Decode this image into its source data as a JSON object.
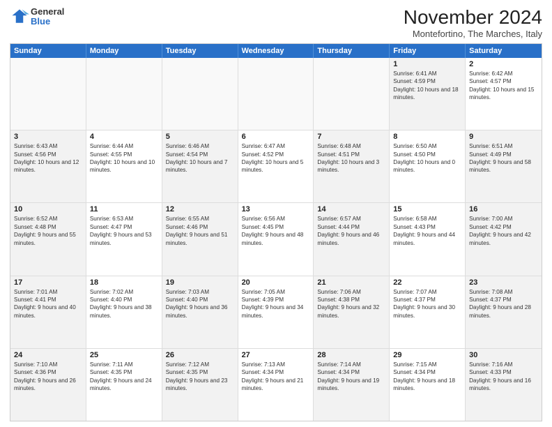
{
  "logo": {
    "general": "General",
    "blue": "Blue"
  },
  "title": "November 2024",
  "location": "Montefortino, The Marches, Italy",
  "weekdays": [
    "Sunday",
    "Monday",
    "Tuesday",
    "Wednesday",
    "Thursday",
    "Friday",
    "Saturday"
  ],
  "rows": [
    [
      {
        "day": "",
        "text": "",
        "empty": true
      },
      {
        "day": "",
        "text": "",
        "empty": true
      },
      {
        "day": "",
        "text": "",
        "empty": true
      },
      {
        "day": "",
        "text": "",
        "empty": true
      },
      {
        "day": "",
        "text": "",
        "empty": true
      },
      {
        "day": "1",
        "text": "Sunrise: 6:41 AM\nSunset: 4:59 PM\nDaylight: 10 hours and 18 minutes.",
        "shaded": true
      },
      {
        "day": "2",
        "text": "Sunrise: 6:42 AM\nSunset: 4:57 PM\nDaylight: 10 hours and 15 minutes.",
        "shaded": false
      }
    ],
    [
      {
        "day": "3",
        "text": "Sunrise: 6:43 AM\nSunset: 4:56 PM\nDaylight: 10 hours and 12 minutes.",
        "shaded": true
      },
      {
        "day": "4",
        "text": "Sunrise: 6:44 AM\nSunset: 4:55 PM\nDaylight: 10 hours and 10 minutes.",
        "shaded": false
      },
      {
        "day": "5",
        "text": "Sunrise: 6:46 AM\nSunset: 4:54 PM\nDaylight: 10 hours and 7 minutes.",
        "shaded": true
      },
      {
        "day": "6",
        "text": "Sunrise: 6:47 AM\nSunset: 4:52 PM\nDaylight: 10 hours and 5 minutes.",
        "shaded": false
      },
      {
        "day": "7",
        "text": "Sunrise: 6:48 AM\nSunset: 4:51 PM\nDaylight: 10 hours and 3 minutes.",
        "shaded": true
      },
      {
        "day": "8",
        "text": "Sunrise: 6:50 AM\nSunset: 4:50 PM\nDaylight: 10 hours and 0 minutes.",
        "shaded": false
      },
      {
        "day": "9",
        "text": "Sunrise: 6:51 AM\nSunset: 4:49 PM\nDaylight: 9 hours and 58 minutes.",
        "shaded": true
      }
    ],
    [
      {
        "day": "10",
        "text": "Sunrise: 6:52 AM\nSunset: 4:48 PM\nDaylight: 9 hours and 55 minutes.",
        "shaded": true
      },
      {
        "day": "11",
        "text": "Sunrise: 6:53 AM\nSunset: 4:47 PM\nDaylight: 9 hours and 53 minutes.",
        "shaded": false
      },
      {
        "day": "12",
        "text": "Sunrise: 6:55 AM\nSunset: 4:46 PM\nDaylight: 9 hours and 51 minutes.",
        "shaded": true
      },
      {
        "day": "13",
        "text": "Sunrise: 6:56 AM\nSunset: 4:45 PM\nDaylight: 9 hours and 48 minutes.",
        "shaded": false
      },
      {
        "day": "14",
        "text": "Sunrise: 6:57 AM\nSunset: 4:44 PM\nDaylight: 9 hours and 46 minutes.",
        "shaded": true
      },
      {
        "day": "15",
        "text": "Sunrise: 6:58 AM\nSunset: 4:43 PM\nDaylight: 9 hours and 44 minutes.",
        "shaded": false
      },
      {
        "day": "16",
        "text": "Sunrise: 7:00 AM\nSunset: 4:42 PM\nDaylight: 9 hours and 42 minutes.",
        "shaded": true
      }
    ],
    [
      {
        "day": "17",
        "text": "Sunrise: 7:01 AM\nSunset: 4:41 PM\nDaylight: 9 hours and 40 minutes.",
        "shaded": true
      },
      {
        "day": "18",
        "text": "Sunrise: 7:02 AM\nSunset: 4:40 PM\nDaylight: 9 hours and 38 minutes.",
        "shaded": false
      },
      {
        "day": "19",
        "text": "Sunrise: 7:03 AM\nSunset: 4:40 PM\nDaylight: 9 hours and 36 minutes.",
        "shaded": true
      },
      {
        "day": "20",
        "text": "Sunrise: 7:05 AM\nSunset: 4:39 PM\nDaylight: 9 hours and 34 minutes.",
        "shaded": false
      },
      {
        "day": "21",
        "text": "Sunrise: 7:06 AM\nSunset: 4:38 PM\nDaylight: 9 hours and 32 minutes.",
        "shaded": true
      },
      {
        "day": "22",
        "text": "Sunrise: 7:07 AM\nSunset: 4:37 PM\nDaylight: 9 hours and 30 minutes.",
        "shaded": false
      },
      {
        "day": "23",
        "text": "Sunrise: 7:08 AM\nSunset: 4:37 PM\nDaylight: 9 hours and 28 minutes.",
        "shaded": true
      }
    ],
    [
      {
        "day": "24",
        "text": "Sunrise: 7:10 AM\nSunset: 4:36 PM\nDaylight: 9 hours and 26 minutes.",
        "shaded": true
      },
      {
        "day": "25",
        "text": "Sunrise: 7:11 AM\nSunset: 4:35 PM\nDaylight: 9 hours and 24 minutes.",
        "shaded": false
      },
      {
        "day": "26",
        "text": "Sunrise: 7:12 AM\nSunset: 4:35 PM\nDaylight: 9 hours and 23 minutes.",
        "shaded": true
      },
      {
        "day": "27",
        "text": "Sunrise: 7:13 AM\nSunset: 4:34 PM\nDaylight: 9 hours and 21 minutes.",
        "shaded": false
      },
      {
        "day": "28",
        "text": "Sunrise: 7:14 AM\nSunset: 4:34 PM\nDaylight: 9 hours and 19 minutes.",
        "shaded": true
      },
      {
        "day": "29",
        "text": "Sunrise: 7:15 AM\nSunset: 4:34 PM\nDaylight: 9 hours and 18 minutes.",
        "shaded": false
      },
      {
        "day": "30",
        "text": "Sunrise: 7:16 AM\nSunset: 4:33 PM\nDaylight: 9 hours and 16 minutes.",
        "shaded": true
      }
    ]
  ]
}
